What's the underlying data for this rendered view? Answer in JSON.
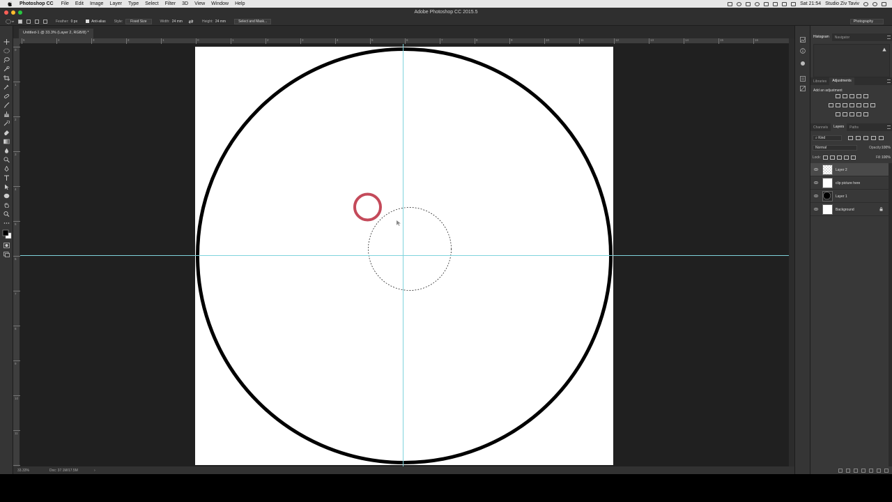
{
  "menubar": {
    "app_name": "Photoshop CC",
    "items": [
      "File",
      "Edit",
      "Image",
      "Layer",
      "Type",
      "Select",
      "Filter",
      "3D",
      "View",
      "Window",
      "Help"
    ],
    "clock": "Sat 21:54",
    "user": "Studio Ziv Taviv"
  },
  "window": {
    "title": "Adobe Photoshop CC 2015.5",
    "document_tab": "Untitled-1 @ 33.3% (Layer 2, RGB/8) *"
  },
  "options": {
    "feather_label": "Feather:",
    "feather_value": "0 px",
    "antialias_label": "Anti-alias",
    "style_label": "Style:",
    "style_value": "Fixed Size",
    "width_label": "Width:",
    "width_value": "24 mm",
    "height_label": "Height:",
    "height_value": "24 mm",
    "select_mask_button": "Select and Mask...",
    "workspace": "Photography"
  },
  "ruler": {
    "horizontal": [
      "5",
      "4",
      "3",
      "2",
      "1",
      "0",
      "1",
      "2",
      "3",
      "4",
      "5",
      "6",
      "7",
      "8",
      "9",
      "10",
      "11",
      "12",
      "13",
      "14",
      "15",
      "16"
    ],
    "vertical": [
      "0",
      "1",
      "2",
      "3",
      "4",
      "5",
      "6",
      "7",
      "8",
      "9",
      "10",
      "11",
      "12"
    ]
  },
  "canvas": {
    "big_circle": "black-outline-circle",
    "highlight_ring": "red-ring",
    "highlight_color": "#c44a5a",
    "guide_color": "#7fd3dc",
    "selection": "elliptical-marquee-selection"
  },
  "status": {
    "zoom": "33.33%",
    "doc": "Doc: 37.1M/17.5M",
    "arrow": "›"
  },
  "panels": {
    "top_tabs": [
      "Histogram",
      "Navigator"
    ],
    "mid_tabs": [
      "Libraries",
      "Adjustments"
    ],
    "adjustments_hint": "Add an adjustment",
    "layer_tabs": [
      "Channels",
      "Layers",
      "Paths"
    ],
    "kind_filter": "Kind",
    "blend_mode": "Normal",
    "opacity_label": "Opacity:",
    "opacity_value": "100%",
    "lock_label": "Lock:",
    "fill_label": "Fill:",
    "fill_value": "100%",
    "layers": [
      {
        "name": "Layer 2",
        "thumb": "checker",
        "selected": true
      },
      {
        "name": "clip picture here",
        "thumb": "white",
        "selected": false
      },
      {
        "name": "Layer 1",
        "thumb": "black-circle",
        "selected": false
      },
      {
        "name": "Background",
        "thumb": "white",
        "selected": false,
        "locked": true
      }
    ]
  }
}
